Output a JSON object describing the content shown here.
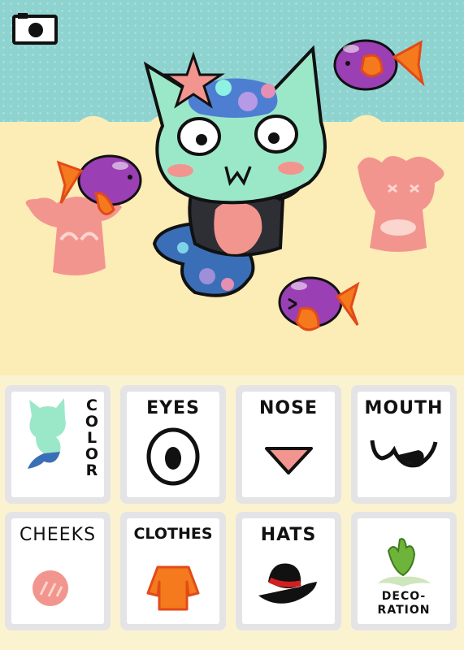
{
  "camera": {
    "icon": "camera-icon"
  },
  "menu": {
    "items": [
      {
        "id": "color",
        "label": "COLOR",
        "icon": "mermaid-cat-icon"
      },
      {
        "id": "eyes",
        "label": "EYES",
        "icon": "eye-icon"
      },
      {
        "id": "nose",
        "label": "NOSE",
        "icon": "triangle-nose-icon"
      },
      {
        "id": "mouth",
        "label": "MOUTH",
        "icon": "cat-mouth-icon"
      },
      {
        "id": "cheeks",
        "label": "CHEEKS",
        "icon": "blush-icon"
      },
      {
        "id": "clothes",
        "label": "CLOTHES",
        "icon": "shirt-icon"
      },
      {
        "id": "hats",
        "label": "HATS",
        "icon": "bowler-hat-icon"
      },
      {
        "id": "decoration",
        "label": "DECO-RATION",
        "label_lines": [
          "DECO-",
          "RATION"
        ],
        "icon": "leaf-decoration-icon"
      }
    ]
  },
  "colors": {
    "sky": "#8ed3cf",
    "sand": "#fcecb6",
    "cat_body": "#9be8c9",
    "fish": "#9b3fb4",
    "coral": "#f3958f",
    "clothes_orange": "#f47a1d"
  }
}
